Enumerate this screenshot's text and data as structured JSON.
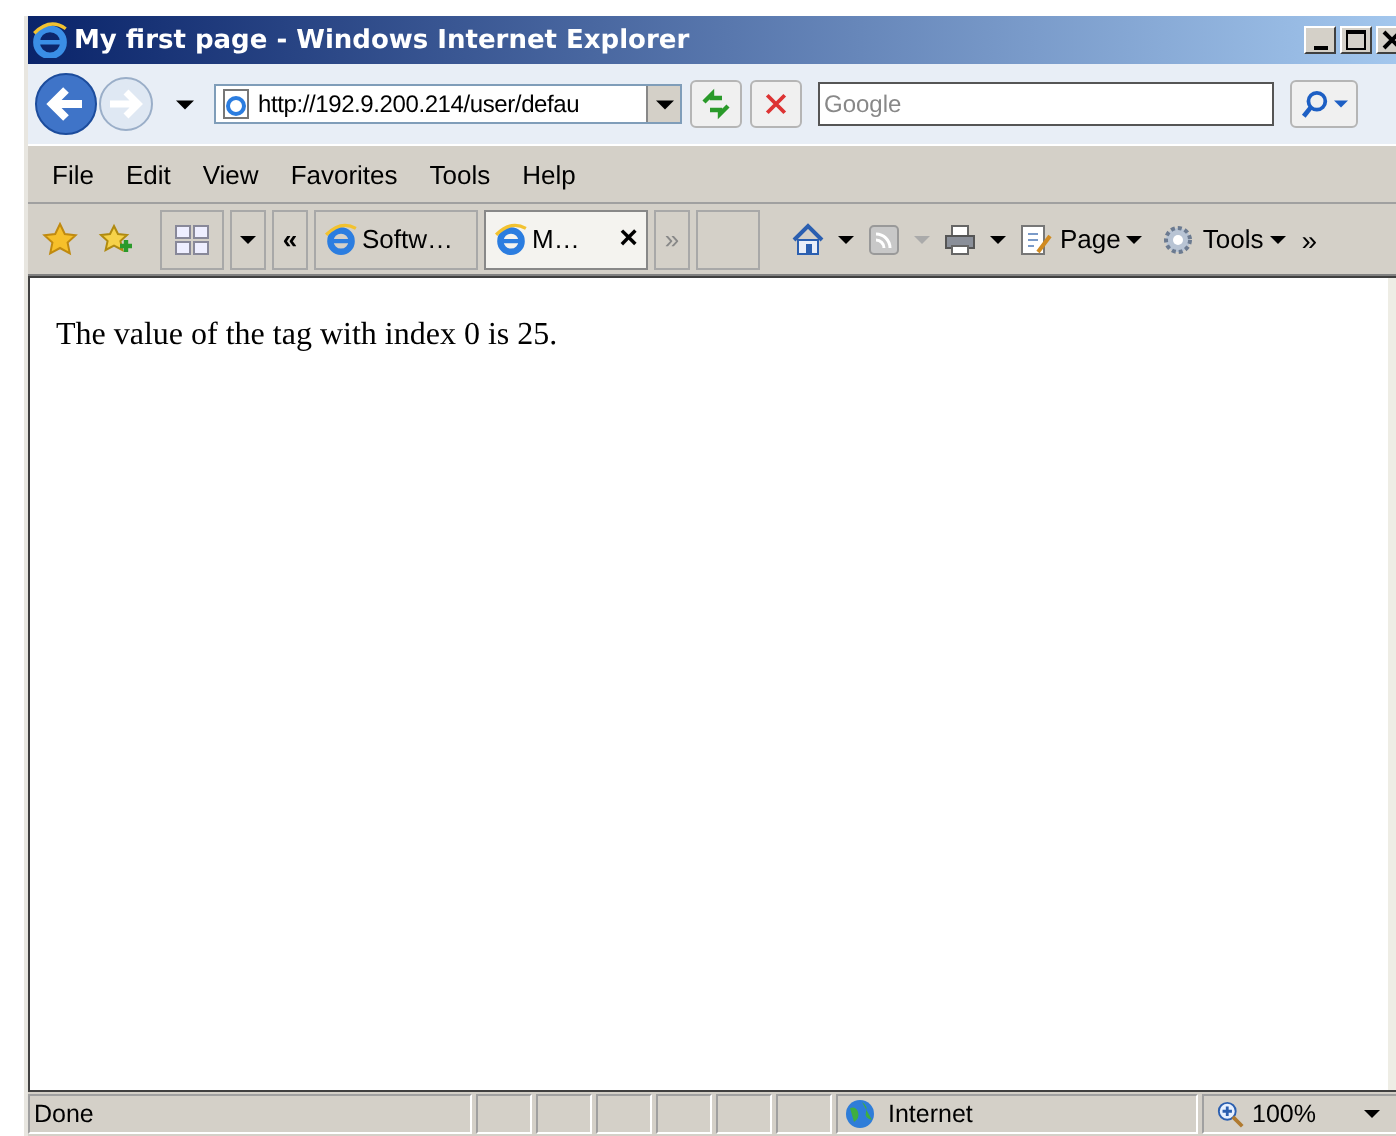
{
  "window": {
    "title": "My first page - Windows Internet Explorer"
  },
  "address_bar": {
    "value": "http://192.9.200.214/user/defau"
  },
  "search": {
    "placeholder": "Google"
  },
  "menu": [
    "File",
    "Edit",
    "View",
    "Favorites",
    "Tools",
    "Help"
  ],
  "tab_nav": {
    "back": "«",
    "forward": "»"
  },
  "tabs": [
    {
      "label": "Softw…",
      "selected": false
    },
    {
      "label": "M…",
      "selected": true,
      "close": "×"
    }
  ],
  "command_bar": [
    "Page",
    "Tools"
  ],
  "command_overflow": "»",
  "content": {
    "text": "The value of the tag with index 0 is 25."
  },
  "status_bar": {
    "text": "Done",
    "zone": "Internet",
    "zoom": "100%"
  }
}
